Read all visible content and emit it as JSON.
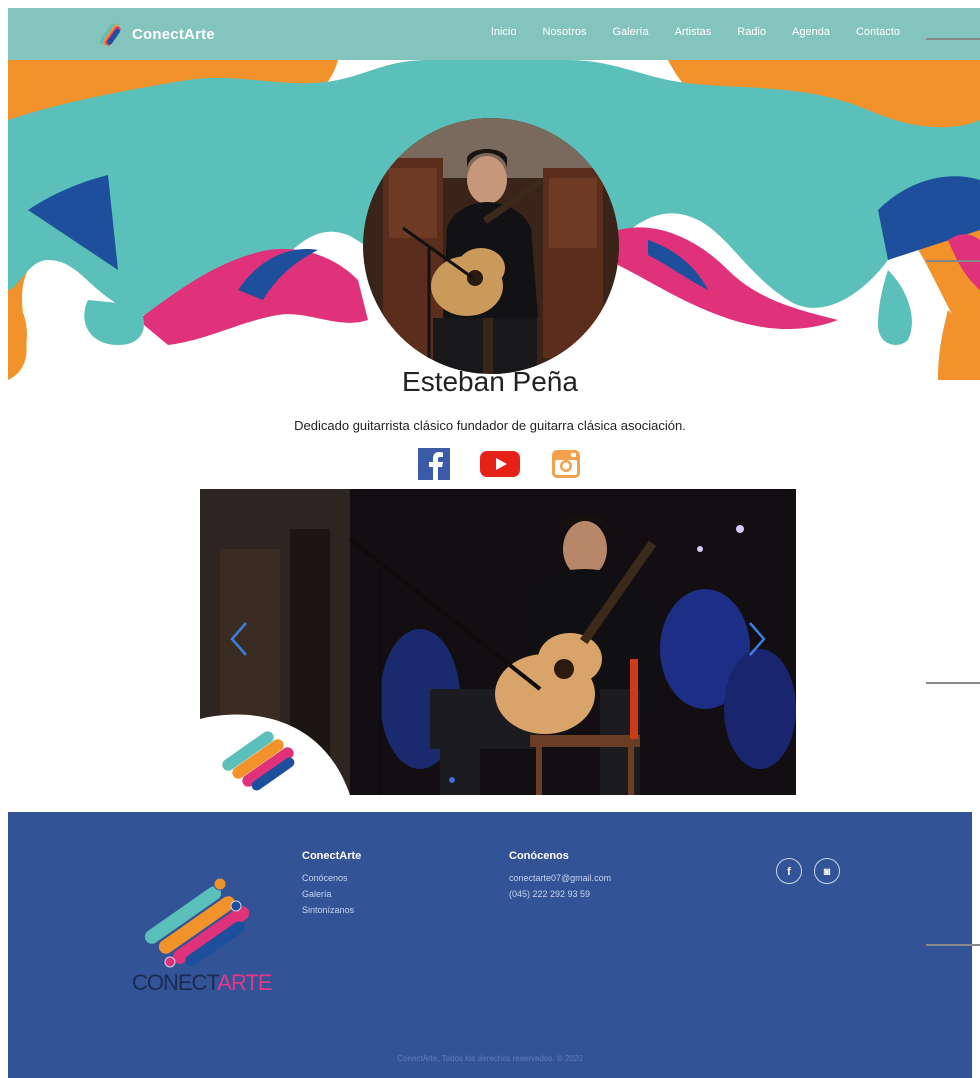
{
  "brand": {
    "name": "ConectArte"
  },
  "nav": {
    "items": [
      {
        "label": "Inicio"
      },
      {
        "label": "Nosotros"
      },
      {
        "label": "Galería"
      },
      {
        "label": "Artistas"
      },
      {
        "label": "Radio"
      },
      {
        "label": "Agenda"
      },
      {
        "label": "Contacto"
      }
    ]
  },
  "artist": {
    "name": "Esteban Peña",
    "bio": "Dedicado guitarrista clásico fundador de guitarra clásica asociación.",
    "socials": [
      "facebook-icon",
      "youtube-icon",
      "instagram-icon"
    ]
  },
  "carousel": {
    "active_slide": 1,
    "slide_count": 1
  },
  "footer": {
    "wordmark_part1": "CONECT",
    "wordmark_part2": "ARTE",
    "col1": {
      "title": "ConectArte",
      "links": [
        "Conócenos",
        "Galería",
        "Sintonízanos"
      ]
    },
    "col2": {
      "title": "Conócenos",
      "email": "conectarte07@gmail.com",
      "phone": "(045) 222 292 93 59"
    },
    "social_icons": [
      "facebook-icon",
      "instagram-icon"
    ],
    "social_glyphs": [
      "f",
      "◙"
    ],
    "copyright": "ConectArte, Todos los derechos reservados. © 2020"
  },
  "colors": {
    "nav": "#83c5bc",
    "teal": "#5cc0ba",
    "orange": "#f2922a",
    "pink": "#e0327a",
    "navy": "#1d4f9c",
    "footer": "#325497"
  }
}
